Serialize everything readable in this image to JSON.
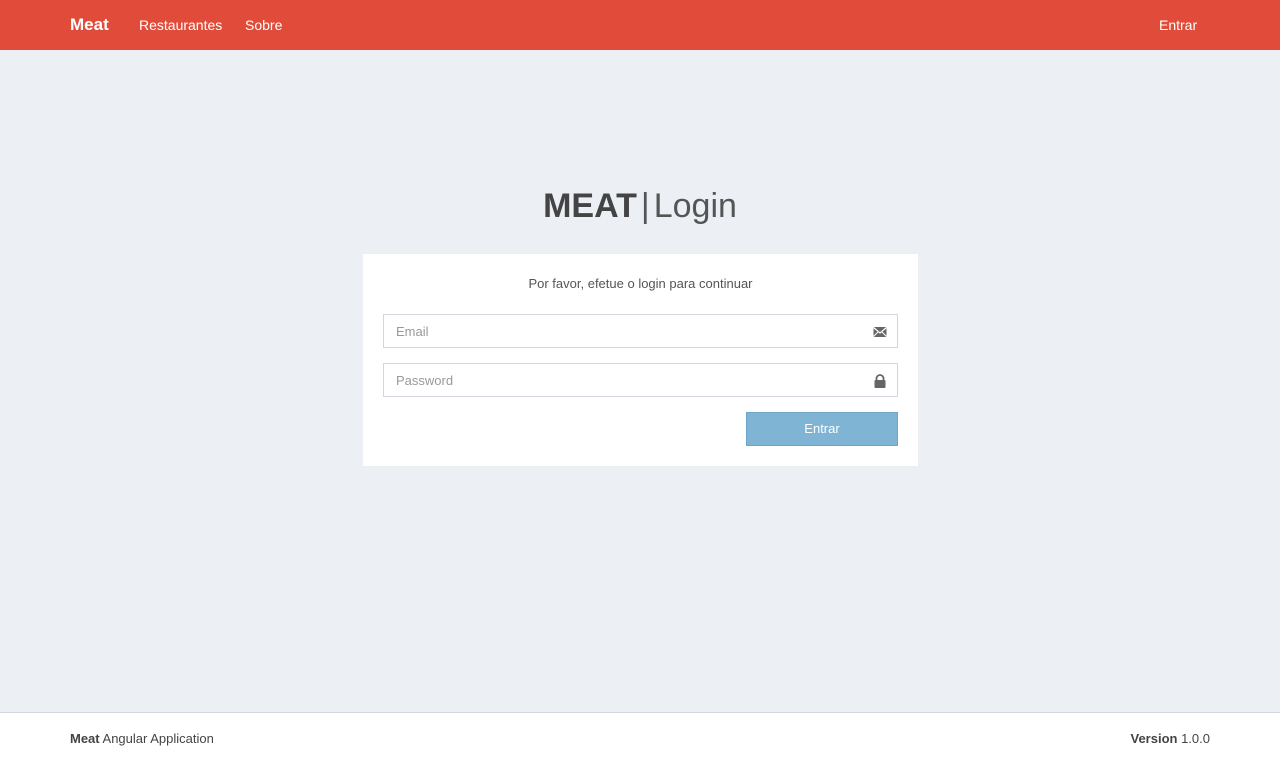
{
  "navbar": {
    "brand": "Meat",
    "links": [
      "Restaurantes",
      "Sobre"
    ],
    "right_link": "Entrar",
    "background": "#e04c39"
  },
  "login": {
    "title_strong": "MEAT",
    "title_separator": "|",
    "title_light": "Login",
    "message": "Por favor, efetue o login para continuar",
    "email": {
      "placeholder": "Email",
      "value": "",
      "icon": "envelope-icon"
    },
    "password": {
      "placeholder": "Password",
      "value": "",
      "icon": "lock-icon"
    },
    "submit_label": "Entrar",
    "submit_color": "#80b4d4"
  },
  "footer": {
    "left_strong": "Meat",
    "left_text": " Angular Application",
    "right_strong": "Version",
    "right_text": " 1.0.0"
  }
}
